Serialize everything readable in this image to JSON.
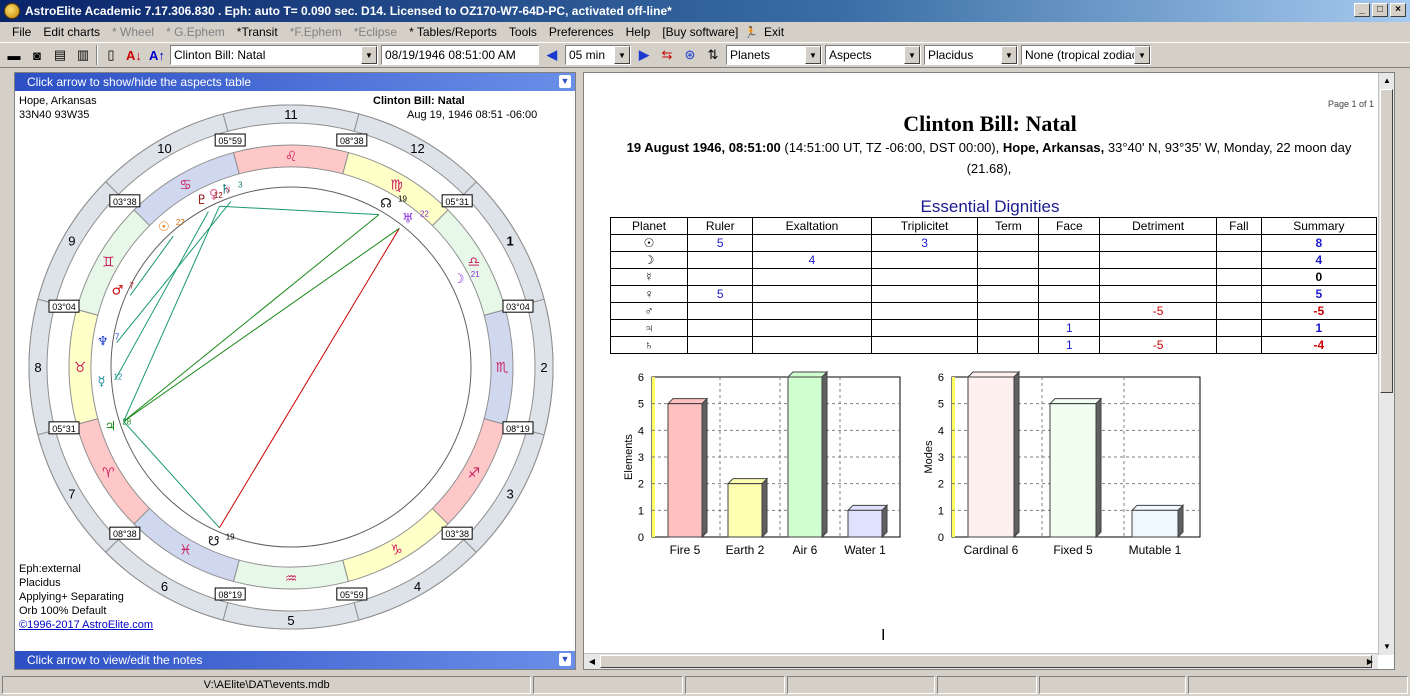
{
  "window": {
    "title": "AstroElite Academic 7.17.306.830 . Eph: auto T= 0.090 sec. D14. Licensed to OZ170-W7-64D-PC, activated off-line*"
  },
  "menu": [
    "File",
    "Edit charts",
    "* Wheel",
    "* G.Ephem",
    "*Transit",
    "*F.Ephem",
    "*Eclipse",
    "* Tables/Reports",
    "Tools",
    "Preferences",
    "Help",
    "[Buy software]",
    "Exit"
  ],
  "menu_dim": [
    false,
    false,
    true,
    true,
    false,
    true,
    true,
    false,
    false,
    false,
    false,
    false,
    false
  ],
  "toolbar": {
    "chart_name": "Clinton Bill: Natal",
    "datetime": "08/19/1946   08:51:00 AM",
    "step": "05 min",
    "planets": "Planets",
    "aspects": "Aspects",
    "houses": "Placidus",
    "zodiac": "None (tropical zodiac)"
  },
  "left_pane": {
    "header": "Click arrow to show/hide the aspects table",
    "footer": "Click arrow to view/edit the notes",
    "location": "Hope, Arkansas",
    "coords": "33N40 93W35",
    "chart_title": "Clinton Bill: Natal",
    "chart_date": "Aug 19, 1946 08:51 -06:00",
    "info": [
      "Eph:external",
      "Placidus",
      "Applying+ Separating",
      "Orb 100% Default"
    ],
    "copyright": "©1996-2017 AstroElite.com",
    "house_numbers": [
      "10",
      "9",
      "8",
      "7",
      "6",
      "5",
      "4",
      "3",
      "2",
      "1",
      "12",
      "11"
    ],
    "cusp_labels": [
      "05°59",
      "03°38",
      "03°04",
      "05°31",
      "08°38",
      "08°19",
      "05°59",
      "03°38",
      "08°19",
      "03°04",
      "05°31",
      "08°38",
      "08°19"
    ],
    "sign_glyphs": [
      "♋",
      "♊",
      "♉",
      "♈",
      "♓",
      "♒",
      "♑",
      "♐",
      "♏",
      "♎",
      "♍",
      "♌"
    ],
    "planet_labels": [
      {
        "glyph": "♅",
        "deg": "22",
        "color": "#8a2be2"
      },
      {
        "glyph": "☊",
        "deg": "19",
        "color": "#000000"
      },
      {
        "glyph": "☽",
        "deg": "21",
        "color": "#8a2be2"
      },
      {
        "glyph": "♄",
        "deg": "3",
        "color": "#1a7a7a"
      },
      {
        "glyph": "♀",
        "deg": "8",
        "color": "#e05a8a"
      },
      {
        "glyph": "♇",
        "deg": "12",
        "color": "#8b0000"
      },
      {
        "glyph": "☉",
        "deg": "27",
        "color": "#e07000"
      },
      {
        "glyph": "♂",
        "deg": "7",
        "color": "#cc0000"
      },
      {
        "glyph": "♆",
        "deg": "7",
        "color": "#1a3ad0"
      },
      {
        "glyph": "☿",
        "deg": "12",
        "color": "#1a8aa0"
      },
      {
        "glyph": "♃",
        "deg": "28",
        "color": "#1a8a1a"
      },
      {
        "glyph": "☋",
        "deg": "19",
        "color": "#000000"
      }
    ]
  },
  "report": {
    "page_of": "Page 1 of 1",
    "title": "Clinton Bill: Natal",
    "date_bold": "19 August 1946, 08:51:00",
    "subtitle_mid": "  (14:51:00 UT, TZ -06:00, DST  00:00), ",
    "place_bold": "Hope, Arkansas,",
    "subtitle_end": " 33°40' N, 93°35' W, Monday, 22 moon day (21.68),",
    "section": "Essential Dignities",
    "columns": [
      "Planet",
      "Ruler",
      "Exaltation",
      "Triplicitet",
      "Term",
      "Face",
      "Detriment",
      "Fall",
      "Summary"
    ],
    "rows": [
      {
        "planet": "☉",
        "ruler": "5",
        "exaltation": "",
        "triplicitet": "3",
        "term": "",
        "face": "",
        "detriment": "",
        "fall": "",
        "summary": "8"
      },
      {
        "planet": "☽",
        "ruler": "",
        "exaltation": "4",
        "triplicitet": "",
        "term": "",
        "face": "",
        "detriment": "",
        "fall": "",
        "summary": "4"
      },
      {
        "planet": "☿",
        "ruler": "",
        "exaltation": "",
        "triplicitet": "",
        "term": "",
        "face": "",
        "detriment": "",
        "fall": "",
        "summary": "0"
      },
      {
        "planet": "♀",
        "ruler": "5",
        "exaltation": "",
        "triplicitet": "",
        "term": "",
        "face": "",
        "detriment": "",
        "fall": "",
        "summary": "5"
      },
      {
        "planet": "♂",
        "ruler": "",
        "exaltation": "",
        "triplicitet": "",
        "term": "",
        "face": "",
        "detriment": "-5",
        "fall": "",
        "summary": "-5"
      },
      {
        "planet": "♃",
        "ruler": "",
        "exaltation": "",
        "triplicitet": "",
        "term": "",
        "face": "1",
        "detriment": "",
        "fall": "",
        "summary": "1"
      },
      {
        "planet": "♄",
        "ruler": "",
        "exaltation": "",
        "triplicitet": "",
        "term": "",
        "face": "1",
        "detriment": "-5",
        "fall": "",
        "summary": "-4"
      }
    ]
  },
  "chart_data": [
    {
      "type": "bar",
      "ylabel": "Elements",
      "categories": [
        "Fire 5",
        "Earth 2",
        "Air 6",
        "Water 1"
      ],
      "values": [
        5,
        2,
        6,
        1
      ],
      "colors": [
        "#ffc0c0",
        "#ffffb0",
        "#d0ffd0",
        "#e0e0ff"
      ],
      "ylim": [
        0,
        6
      ],
      "yticks": [
        "0",
        "1",
        "2",
        "3",
        "4",
        "5",
        "6"
      ],
      "grid": true
    },
    {
      "type": "bar",
      "ylabel": "Modes",
      "categories": [
        "Cardinal 6",
        "Fixed 5",
        "Mutable 1"
      ],
      "values": [
        6,
        5,
        1
      ],
      "colors": [
        "#fff0f0",
        "#f0fff0",
        "#f0f8ff"
      ],
      "ylim": [
        0,
        6
      ],
      "yticks": [
        "0",
        "1",
        "2",
        "3",
        "4",
        "5",
        "6"
      ],
      "grid": true
    }
  ],
  "status": {
    "path": "V:\\AElite\\DAT\\events.mdb"
  }
}
